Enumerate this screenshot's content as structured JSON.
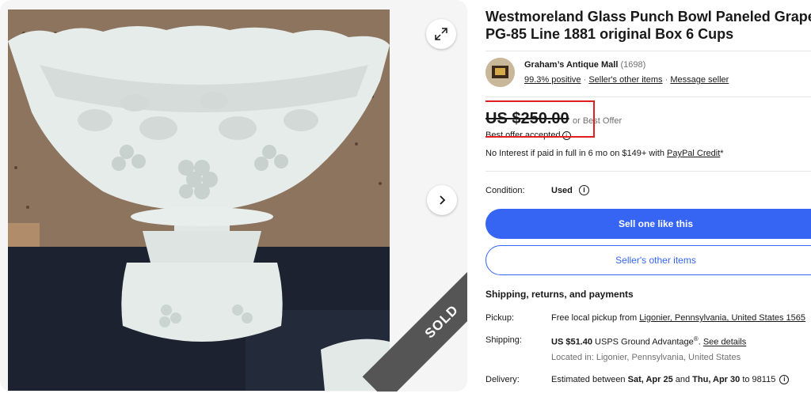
{
  "listing": {
    "title_line1": "Westmoreland Glass Punch Bowl Paneled Grape",
    "title_line2": "PG-85 Line 1881 original Box 6 Cups",
    "sold_label": "SOLD"
  },
  "seller": {
    "name": "Graham’s Antique Mall",
    "feedback_count": "(1698)",
    "positive": "99.3% positive",
    "sep1": " · ",
    "other_items": "Seller's other items",
    "sep2": " · ",
    "message": "Message seller"
  },
  "price": {
    "amount": "US $250.00",
    "best_offer": "or Best Offer",
    "offer_accepted": "Best offer accepted",
    "paypal_prefix": "No Interest if paid in full in 6 mo on $149+ with ",
    "paypal_link": "PayPal Credit",
    "paypal_suffix": "*"
  },
  "condition": {
    "label": "Condition:",
    "value": "Used"
  },
  "buttons": {
    "sell_one": "Sell one like this",
    "sellers_other": "Seller's other items"
  },
  "shipping": {
    "section_title": "Shipping, returns, and payments",
    "pickup_label": "Pickup:",
    "pickup_prefix": "Free local pickup from ",
    "pickup_link": "Ligonier, Pennsylvania, United States 1565",
    "shipping_label": "Shipping:",
    "shipping_price": "US $51.40",
    "shipping_service": " USPS Ground Advantage",
    "shipping_reg": "®",
    "shipping_sep": ". ",
    "see_details": "See details",
    "located_in": "Located in: Ligonier, Pennsylvania, United States",
    "delivery_label": "Delivery:",
    "delivery_prefix": "Estimated between ",
    "delivery_start": "Sat, Apr 25",
    "delivery_and": " and ",
    "delivery_end": "Thu, Apr 30",
    "delivery_suffix": " to 98115 "
  },
  "icons": {
    "fullscreen": "expand-icon",
    "next": "chevron-right-icon",
    "info": "info-icon"
  },
  "colors": {
    "accent": "#3665f3",
    "highlight": "#e02020",
    "sold_ribbon": "#555555"
  }
}
